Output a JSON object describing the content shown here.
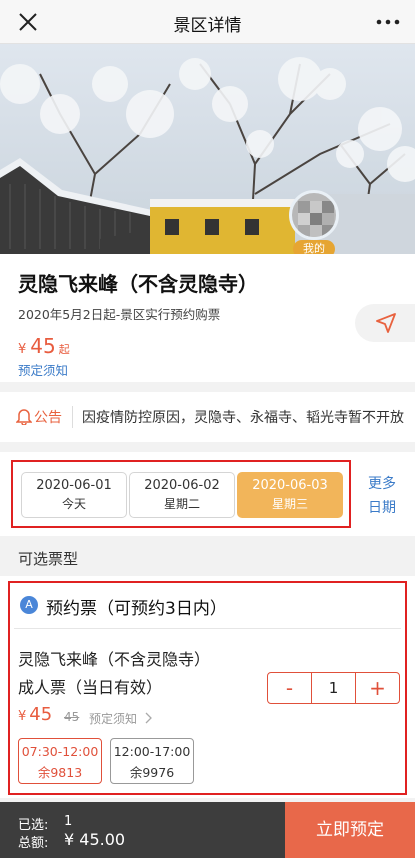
{
  "titlebar": {
    "title": "景区详情"
  },
  "hero": {
    "avatar_tag": "我的"
  },
  "scenic": {
    "name": "灵隐飞来峰（不含灵隐寺）",
    "notice": "2020年5月2日起-景区实行预约购票",
    "currency": "¥",
    "price": "45",
    "price_suffix": "起",
    "rules_link": "预定须知"
  },
  "announcement": {
    "label": "公告",
    "text": "因疫情防控原因，灵隐寺、永福寺、韬光寺暂不开放"
  },
  "dates": {
    "items": [
      {
        "date": "2020-06-01",
        "weekday": "今天",
        "selected": false
      },
      {
        "date": "2020-06-02",
        "weekday": "星期二",
        "selected": false
      },
      {
        "date": "2020-06-03",
        "weekday": "星期三",
        "selected": true
      }
    ],
    "more_line1": "更多",
    "more_line2": "日期"
  },
  "section": {
    "title": "可选票型"
  },
  "ticket": {
    "badge": "A",
    "type": "预约票（可预约3日内）",
    "name": "灵隐飞来峰（不含灵隐寺）",
    "subname": "成人票（当日有效）",
    "currency": "¥",
    "price": "45",
    "original_price": "45",
    "rules_link": "预定须知",
    "quantity": "1",
    "minus": "-",
    "plus": "+",
    "slots": [
      {
        "time": "07:30-12:00",
        "remain": "余9813",
        "selected": true
      },
      {
        "time": "12:00-17:00",
        "remain": "余9976",
        "selected": false
      }
    ]
  },
  "bottom": {
    "selected_label": "已选:",
    "selected_value": "1",
    "total_label": "总额:",
    "total_value": "¥ 45.00",
    "book_button": "立即预定"
  },
  "colors": {
    "accent": "#e8684a",
    "price": "#e85c3f",
    "link": "#3b7bc8",
    "selected_date": "#f2b55a",
    "highlight_box": "#e02121"
  },
  "icons": [
    "close-icon",
    "more-icon",
    "navigate-icon",
    "bell-icon",
    "chevron-right-icon"
  ]
}
